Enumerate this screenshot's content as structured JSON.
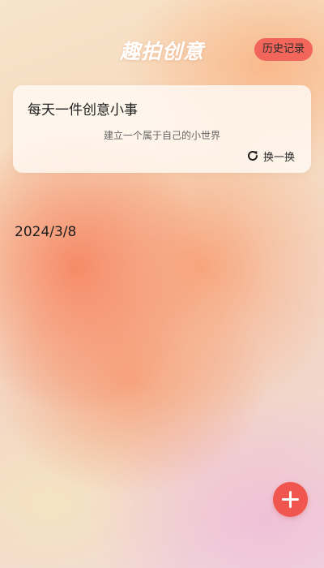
{
  "header": {
    "title": "趣拍创意",
    "history_label": "历史记录"
  },
  "idea_card": {
    "title": "每天一件创意小事",
    "subtitle": "建立一个属于自己的小世界",
    "refresh_label": "换一换",
    "refresh_icon": "refresh-icon"
  },
  "date": "2024/3/8",
  "fab": {
    "icon": "plus-icon"
  },
  "colors": {
    "accent": "#f0564d",
    "history_button_bg": "#f2655a",
    "card_bg": "#fffaf4"
  }
}
